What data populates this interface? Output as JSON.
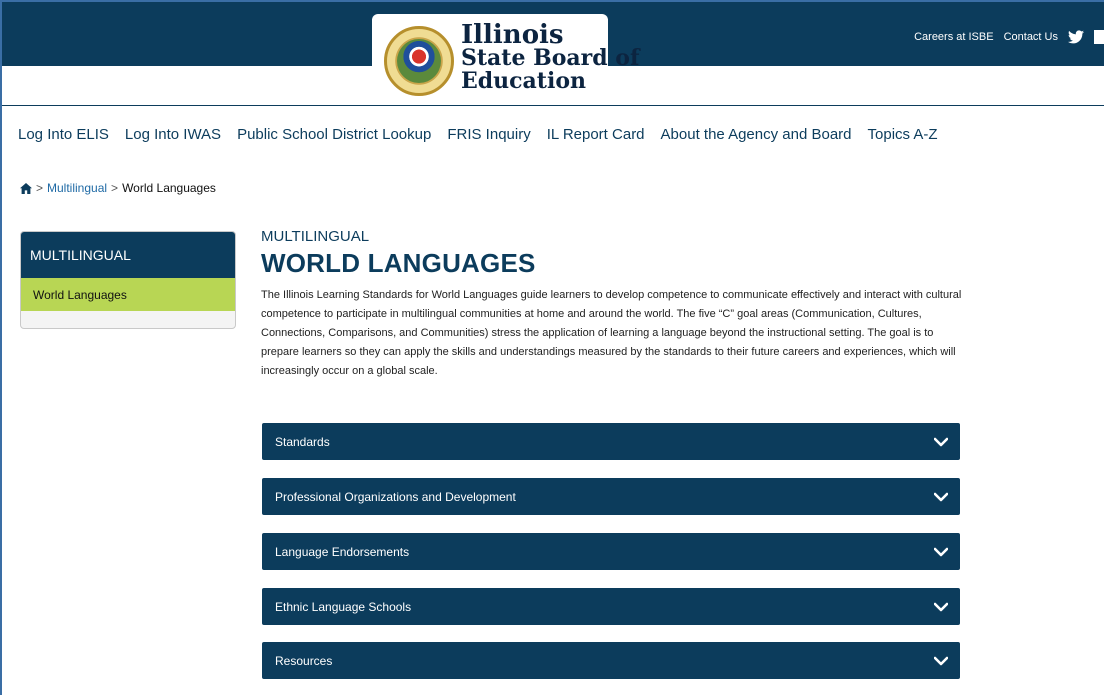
{
  "header": {
    "logo_line1": "Illinois",
    "logo_line2": "State Board of",
    "logo_line3": "Education",
    "utility_links": [
      "Careers at ISBE",
      "Contact Us"
    ]
  },
  "main_nav": {
    "items": [
      "Log Into ELIS",
      "Log Into IWAS",
      "Public School District Lookup",
      "FRIS Inquiry",
      "IL Report Card",
      "About the Agency and Board",
      "Topics A-Z"
    ]
  },
  "breadcrumb": {
    "separator": ">",
    "items": [
      "Multilingual",
      "World Languages"
    ]
  },
  "sidebar": {
    "title": "MULTILINGUAL",
    "items": [
      "World Languages"
    ]
  },
  "content": {
    "eyebrow": "MULTILINGUAL",
    "title": "WORLD LANGUAGES",
    "intro": "The Illinois Learning Standards for World Languages guide learners to develop competence to communicate effectively and interact with cultural competence to participate in multilingual communities at home and around the world. The five “C” goal areas (Communication, Cultures, Connections, Comparisons, and Communities) stress the application of learning a language beyond the instructional setting. The goal is to prepare learners so they can apply the skills and understandings measured by the standards to their future careers and experiences, which will increasingly occur on a global scale."
  },
  "accordions": [
    "Standards",
    "Professional Organizations and Development",
    "Language Endorsements",
    "Ethnic Language Schools",
    "Resources"
  ],
  "colors": {
    "navy": "#0c3c5c",
    "active_green": "#b8d654",
    "link_blue": "#1f6aa5"
  }
}
